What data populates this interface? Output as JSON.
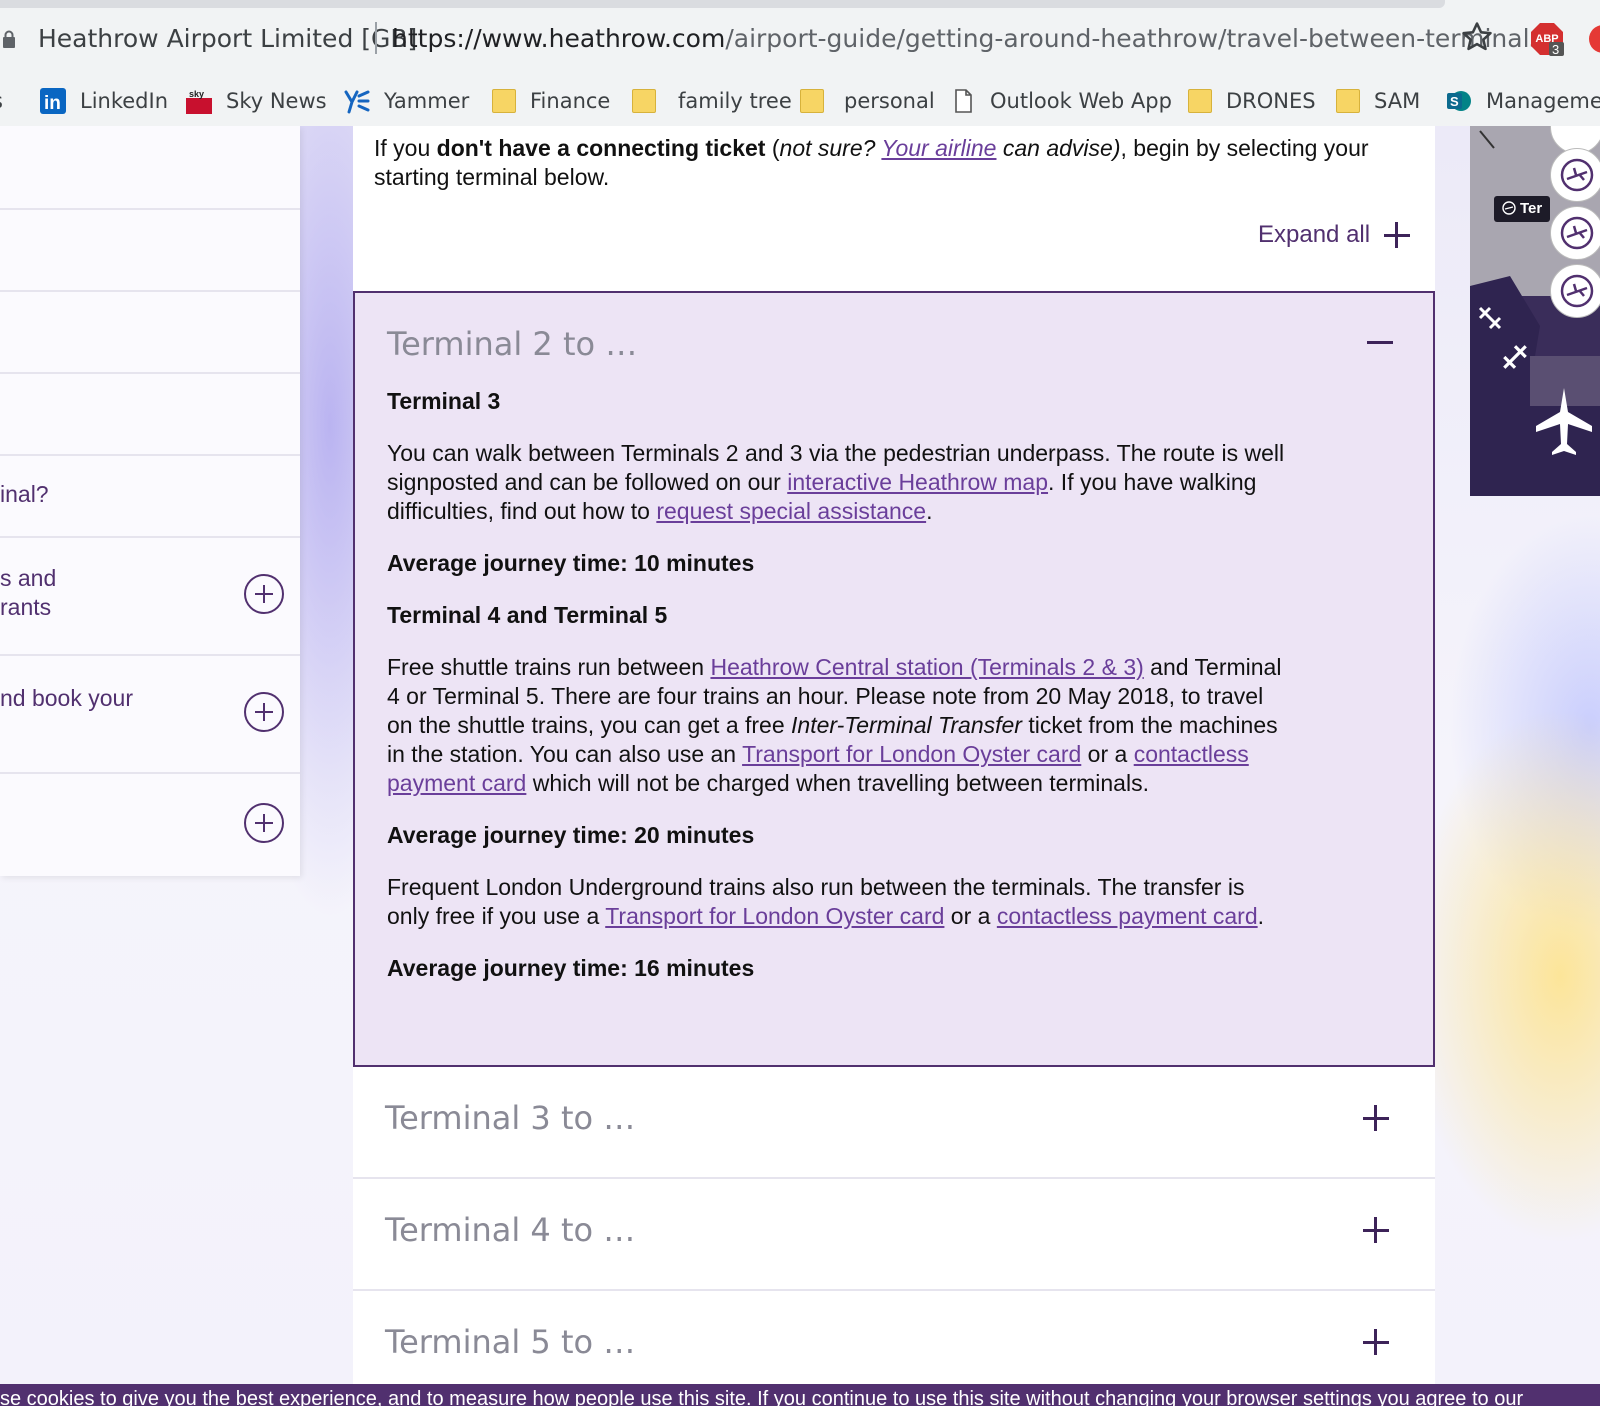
{
  "browser": {
    "site_identity": "Heathrow Airport Limited [GB]",
    "url_host": "https://www.heathrow.com",
    "url_path": "/airport-guide/getting-around-heathrow/travel-between-terminals",
    "abp_badge": "3",
    "bookmarks": [
      {
        "label": "s",
        "icon": "folder-icon"
      },
      {
        "label": "LinkedIn",
        "icon": "linkedin-icon"
      },
      {
        "label": "Sky News",
        "icon": "sky-news-icon"
      },
      {
        "label": "Yammer",
        "icon": "yammer-icon"
      },
      {
        "label": "Finance",
        "icon": "folder-icon"
      },
      {
        "label": "family tree",
        "icon": "folder-icon"
      },
      {
        "label": "personal",
        "icon": "folder-icon"
      },
      {
        "label": "Outlook Web App",
        "icon": "page-icon"
      },
      {
        "label": "DRONES",
        "icon": "folder-icon"
      },
      {
        "label": "SAM",
        "icon": "folder-icon"
      },
      {
        "label": "Managemen",
        "icon": "sharepoint-icon"
      }
    ]
  },
  "sidebar": {
    "items": [
      {
        "label": ""
      },
      {
        "label": ""
      },
      {
        "label": ""
      },
      {
        "label": ""
      },
      {
        "label": "inal?"
      },
      {
        "label": "s and\nrants"
      },
      {
        "label": "nd book your"
      },
      {
        "label": ""
      }
    ]
  },
  "main": {
    "intro_pre": "If you ",
    "intro_bold": "don't have a connecting ticket",
    "intro_paren_open": " (",
    "intro_italic": "not sure? ",
    "intro_link": "Your airline",
    "intro_italic2": " can advise)",
    "intro_post": ", begin by selecting your starting terminal below.",
    "expand_all": "Expand all",
    "open_section": {
      "title": "Terminal 2 to …",
      "t3_heading": "Terminal 3",
      "t3_p_1": "You can walk between Terminals 2 and 3 via the pedestrian underpass. The route is well signposted and can be followed on our ",
      "t3_link_map": "interactive Heathrow map",
      "t3_p_2": ". If you have walking difficulties, find out how to ",
      "t3_link_assist": "request special assistance",
      "t3_p_3": ".",
      "t3_time": "Average journey time: 10 minutes",
      "t45_heading": "Terminal 4 and Terminal 5",
      "t45_p_1": "Free shuttle trains run between ",
      "t45_link_central": "Heathrow Central station (Terminals 2 & 3)",
      "t45_p_2": " and Terminal 4 or Terminal 5. There are four trains an hour. Please note from 20 May 2018, to travel on the shuttle trains, you can get a free ",
      "t45_italic": "Inter-Terminal Transfer",
      "t45_p_3": " ticket from the machines in the station. You can also use an ",
      "t45_link_oyster": "Transport for London Oyster card",
      "t45_p_4": " or a ",
      "t45_link_contactless": "contactless payment card",
      "t45_p_5": " which will not be charged when travelling between terminals.",
      "t45_time": "Average journey time: 20 minutes",
      "ug_p_1": "Frequent London Underground trains also run between the terminals. The transfer is only free if you use a ",
      "ug_link_oyster": "Transport for London Oyster card",
      "ug_p_2": " or a ",
      "ug_link_contactless": "contactless payment card",
      "ug_p_3": ".",
      "ug_time": "Average journey time: 16 minutes"
    },
    "closed_sections": [
      {
        "title": "Terminal 3 to …"
      },
      {
        "title": "Terminal 4 to …"
      },
      {
        "title": "Terminal 5 to …"
      }
    ]
  },
  "map": {
    "terminal_tag": "Ter"
  },
  "cookie_bar": {
    "text": "se cookies to give you the best experience, and to measure how people use this site. If you continue to use this site without changing your browser settings you agree to our"
  },
  "colors": {
    "brand_purple": "#51306f",
    "link_purple": "#6a3e9a",
    "open_panel_bg": "#ede4f5"
  }
}
